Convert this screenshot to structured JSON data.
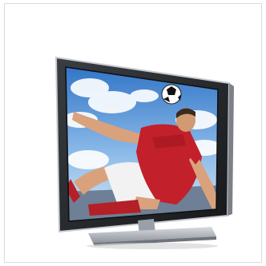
{
  "product": {
    "kind": "television",
    "scene": "soccer-player-bicycle-kick",
    "colors": {
      "bezel": "#2a2c30",
      "bezel_trim": "#c9ccd1",
      "sky": "#3f86d4",
      "jersey": "#c2202a",
      "shorts": "#f2f2f2",
      "stand": "#b8bcc2"
    }
  }
}
